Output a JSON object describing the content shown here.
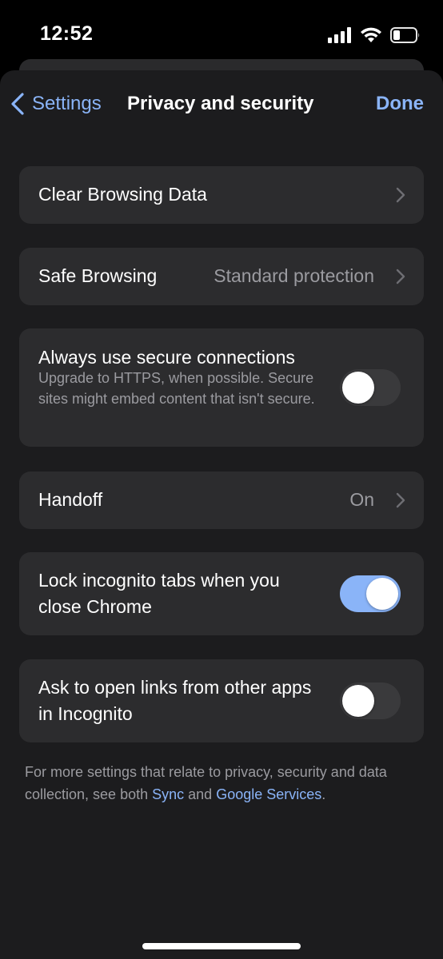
{
  "status_bar": {
    "time": "12:52",
    "icons": [
      "cellular-signal-icon",
      "wifi-icon",
      "battery-icon"
    ]
  },
  "nav": {
    "back_label": "Settings",
    "title": "Privacy and security",
    "done_label": "Done"
  },
  "rows": {
    "clear_browsing": {
      "label": "Clear Browsing Data"
    },
    "safe_browsing": {
      "label": "Safe Browsing",
      "value": "Standard protection"
    },
    "secure_connections": {
      "label": "Always use secure connections",
      "description": "Upgrade to HTTPS, when possible. Secure sites might embed content that isn't secure.",
      "enabled": false
    },
    "handoff": {
      "label": "Handoff",
      "value": "On"
    },
    "lock_incognito": {
      "label": "Lock incognito tabs when you close Chrome",
      "enabled": true
    },
    "ask_incognito": {
      "label": "Ask to open links from other apps in Incognito",
      "enabled": false
    }
  },
  "footer": {
    "text_before": "For more settings that relate to privacy, security and data collection, see both ",
    "sync_link": "Sync",
    "text_middle": " and ",
    "services_link": "Google Services",
    "text_after": "."
  },
  "colors": {
    "accent": "#8ab4f8",
    "background": "#1c1c1e",
    "card": "#2c2c2e",
    "secondary_text": "#9b9ba0"
  }
}
